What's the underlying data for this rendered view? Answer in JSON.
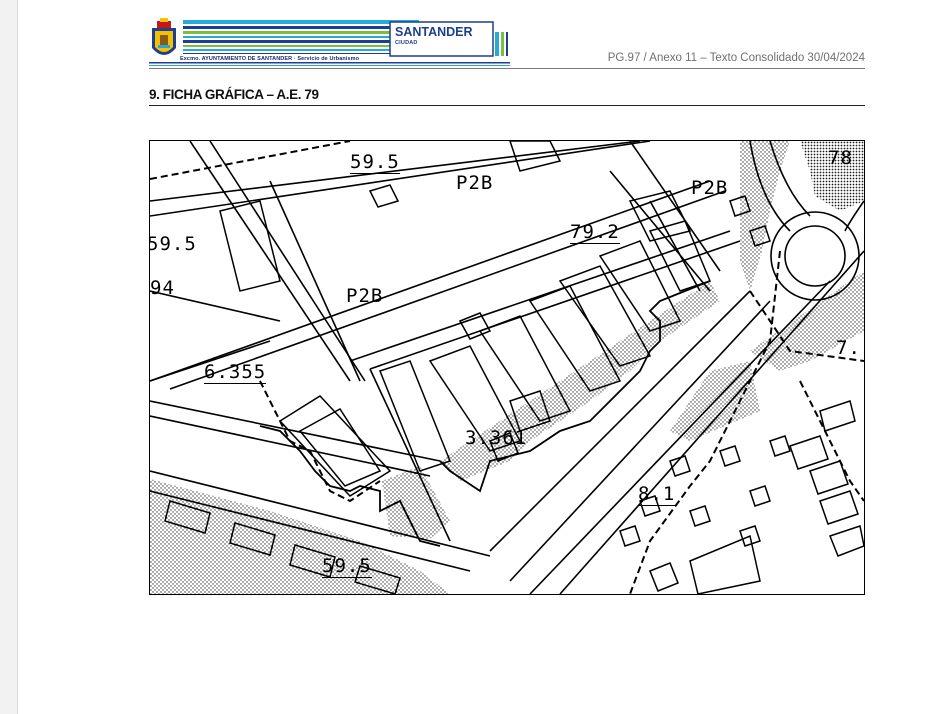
{
  "header": {
    "logo_caption": "Excmo. AYUNTAMIENTO DE SANTANDER · Servicio de Urbanismo",
    "logo_brand": "SANTANDER",
    "logo_sub": "CIUDAD",
    "doc_ref": "PG.97 / Anexo 11 – Texto Consolidado 30/04/2024"
  },
  "section": {
    "title": "9.  FICHA GRÁFICA – A.E. 79"
  },
  "map": {
    "labels": {
      "h59_5_top": "59.5",
      "p2b_top": "P2B",
      "p2b_right": "P2B",
      "n78": "78",
      "n79_2": "79.2",
      "h59_5_left": "59.5",
      "n94": "94",
      "p2b_center": "P2B",
      "n6_355": "6.355",
      "n7": "7.",
      "n3_361": "3.361",
      "n8_1": "8.1",
      "h59_5_bottom": "59.5"
    }
  },
  "colors": {
    "logo_blue": "#1d3f8f",
    "logo_cyan": "#29a9d6",
    "logo_green": "#7bbf3f"
  }
}
